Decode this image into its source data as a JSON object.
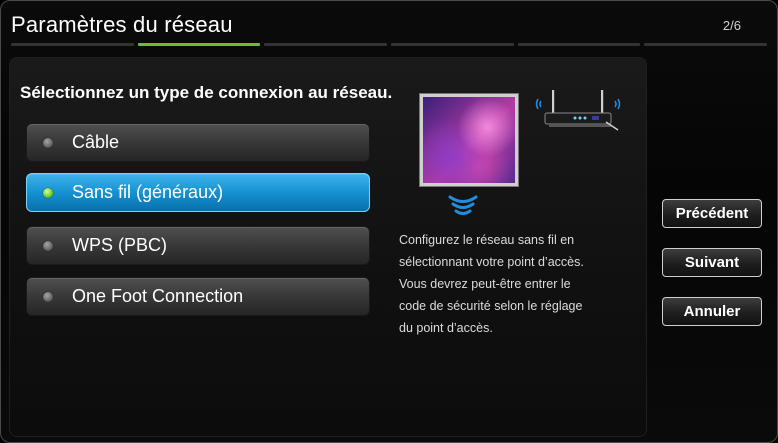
{
  "header": {
    "title": "Paramètres du réseau",
    "step": "2/6",
    "progress": {
      "total_steps": 6,
      "current_step": 2
    }
  },
  "main": {
    "prompt": "Sélectionnez un type de connexion au réseau.",
    "options": [
      {
        "label": "Câble",
        "selected": false
      },
      {
        "label": "Sans fil (généraux)",
        "selected": true
      },
      {
        "label": "WPS (PBC)",
        "selected": false
      },
      {
        "label": "One Foot Connection",
        "selected": false
      }
    ],
    "description": [
      "Configurez le réseau sans fil en",
      "sélectionnant votre point d’accès.",
      "Vous devrez peut-être entrer le",
      "code de sécurité selon le réglage",
      "du point d’accès."
    ]
  },
  "side_buttons": {
    "previous": "Précédent",
    "next": "Suivant",
    "cancel": "Annuler"
  },
  "colors": {
    "accent_selected": "#1f9bd9",
    "progress_active": "#6dbd2e",
    "indicator_selected": "#6ecb2a",
    "wifi_waves": "#1e8fe0"
  },
  "icons": {
    "illustration_tv": "tv-illustration",
    "wireless": "wifi-waves-icon",
    "router": "router-icon"
  }
}
